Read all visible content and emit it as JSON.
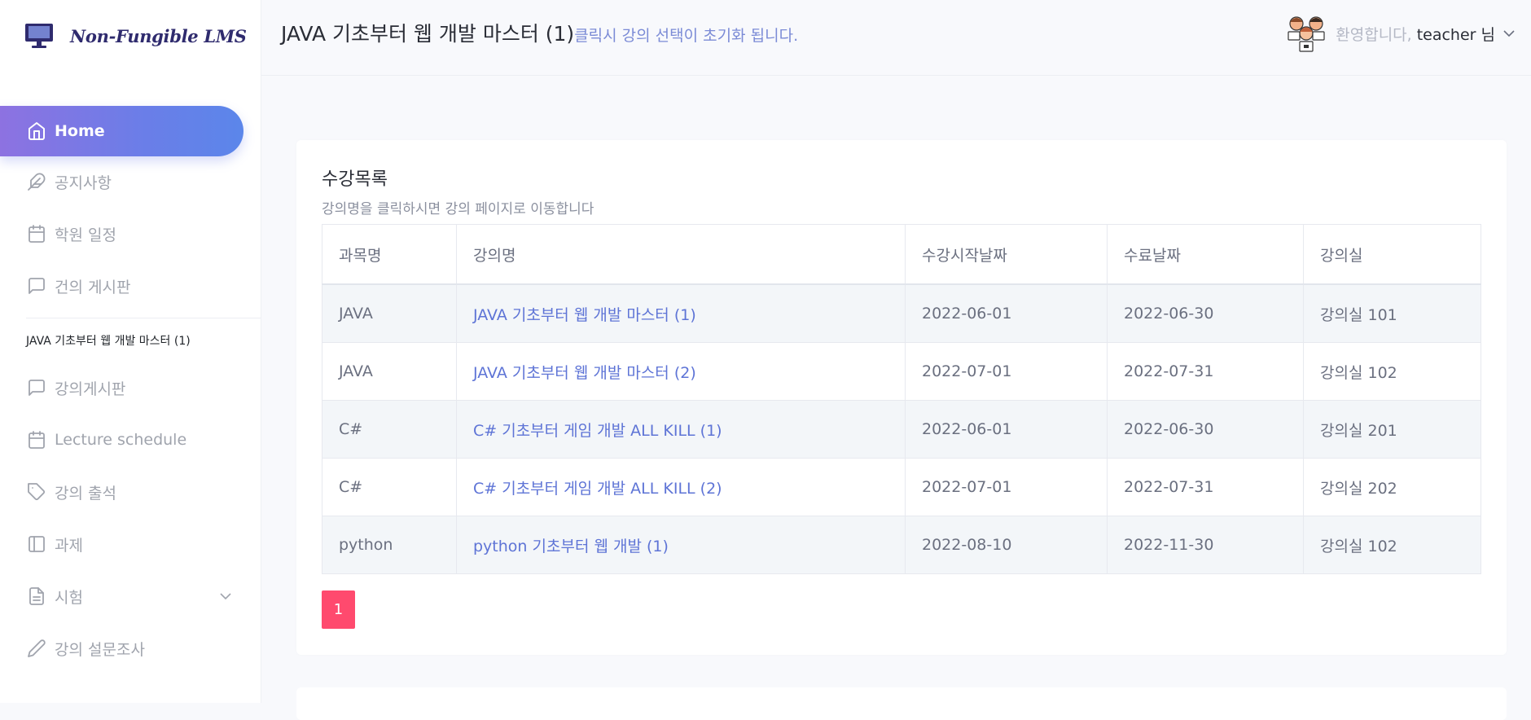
{
  "app": {
    "logo_text": "Non-Fungible LMS"
  },
  "header": {
    "course_title": "JAVA 기초부터 웹 개발 마스터 (1)",
    "course_hint": "클릭시 강의 선택이 초기화 됩니다.",
    "welcome": "환영합니다,",
    "username": "teacher 님"
  },
  "sidebar": {
    "items": [
      {
        "label": "Home",
        "icon": "home-icon"
      },
      {
        "label": "공지사항",
        "icon": "feather-icon"
      },
      {
        "label": "학원 일정",
        "icon": "calendar-icon"
      },
      {
        "label": "건의 게시판",
        "icon": "message-icon"
      }
    ],
    "section_title": "JAVA 기초부터 웹 개발 마스터 (1)",
    "course_items": [
      {
        "label": "강의게시판",
        "icon": "message-icon"
      },
      {
        "label": "Lecture schedule",
        "icon": "calendar-icon"
      },
      {
        "label": "강의 출석",
        "icon": "tag-icon"
      },
      {
        "label": "과제",
        "icon": "sidebar-icon"
      },
      {
        "label": "시험",
        "icon": "file-icon"
      },
      {
        "label": "강의 설문조사",
        "icon": "pen-icon"
      }
    ]
  },
  "card": {
    "title": "수강목록",
    "subtitle": "강의명을 클릭하시면 강의 페이지로 이동합니다",
    "columns": [
      "과목명",
      "강의명",
      "수강시작날짜",
      "수료날짜",
      "강의실"
    ],
    "rows": [
      [
        "JAVA",
        "JAVA 기초부터 웹 개발 마스터 (1)",
        "2022-06-01",
        "2022-06-30",
        "강의실 101"
      ],
      [
        "JAVA",
        "JAVA 기초부터 웹 개발 마스터 (2)",
        "2022-07-01",
        "2022-07-31",
        "강의실 102"
      ],
      [
        "C#",
        "C# 기초부터 게임 개발 ALL KILL (1)",
        "2022-06-01",
        "2022-06-30",
        "강의실 201"
      ],
      [
        "C#",
        "C# 기초부터 게임 개발 ALL KILL (2)",
        "2022-07-01",
        "2022-07-31",
        "강의실 202"
      ],
      [
        "python",
        "python 기초부터 웹 개발 (1)",
        "2022-08-10",
        "2022-11-30",
        "강의실 102"
      ]
    ],
    "page": "1"
  },
  "colors": {
    "accent_gradient_start": "#8d72e1",
    "accent_gradient_end": "#5b86ea",
    "link": "#5e74d6",
    "pager": "#ff4a6e"
  }
}
